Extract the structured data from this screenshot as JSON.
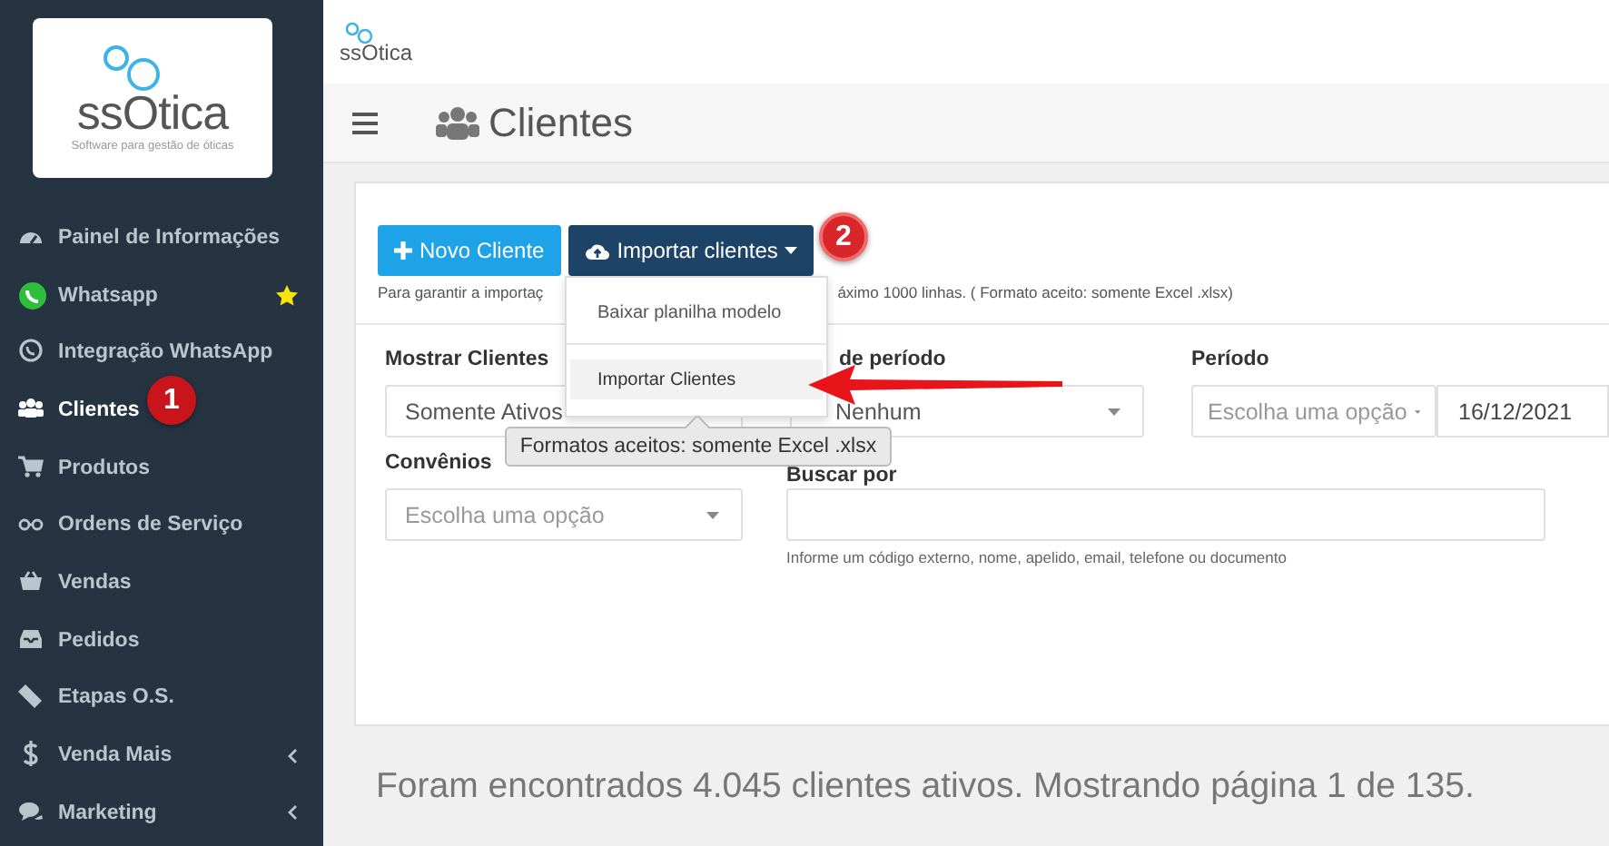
{
  "brand": {
    "logo": "ssOtica",
    "tagline": "Software para gestão de óticas",
    "header_logo": "ssOtica"
  },
  "sidebar": {
    "items": [
      {
        "label": "Painel de Informações",
        "selected": false,
        "starred": false,
        "expandable": false
      },
      {
        "label": "Whatsapp",
        "selected": false,
        "starred": true,
        "expandable": false
      },
      {
        "label": "Integração WhatsApp",
        "selected": false,
        "starred": false,
        "expandable": false
      },
      {
        "label": "Clientes",
        "selected": true,
        "starred": false,
        "expandable": false
      },
      {
        "label": "Produtos",
        "selected": false,
        "starred": false,
        "expandable": false
      },
      {
        "label": "Ordens de Serviço",
        "selected": false,
        "starred": false,
        "expandable": false
      },
      {
        "label": "Vendas",
        "selected": false,
        "starred": false,
        "expandable": false
      },
      {
        "label": "Pedidos",
        "selected": false,
        "starred": false,
        "expandable": false
      },
      {
        "label": "Etapas O.S.",
        "selected": false,
        "starred": false,
        "expandable": false
      },
      {
        "label": "Venda Mais",
        "selected": false,
        "starred": false,
        "expandable": true
      },
      {
        "label": "Marketing",
        "selected": false,
        "starred": false,
        "expandable": true
      }
    ]
  },
  "page": {
    "title": "Clientes"
  },
  "toolbar": {
    "buttons": [
      {
        "label": "Novo Cliente",
        "kind": "primary"
      },
      {
        "label": "Importar clientes",
        "kind": "dropdown"
      }
    ],
    "hint_left": "Para garantir a importaç",
    "hint_right": "áximo 1000 linhas. ( Formato aceito: somente Excel .xlsx)"
  },
  "dropdown_menu": {
    "items": [
      {
        "label": "Baixar planilha modelo",
        "selected": false
      },
      {
        "label": "Importar Clientes",
        "selected": true
      }
    ]
  },
  "tooltip": "Formatos aceitos: somente Excel .xlsx",
  "filters": {
    "show": {
      "label": "Mostrar Clientes",
      "value": "Somente Ativos"
    },
    "period_type": {
      "label": "de período",
      "value": "Nenhum"
    },
    "period": {
      "label": "Período",
      "placeholder": "Escolha uma opção",
      "date": "16/12/2021"
    },
    "agreements": {
      "label": "Convênios",
      "placeholder": "Escolha uma opção"
    },
    "search": {
      "label": "Buscar por",
      "help": "Informe um código externo, nome, apelido, email, telefone ou documento"
    }
  },
  "callouts": [
    {
      "number": "1"
    },
    {
      "number": "2"
    }
  ],
  "summary": "Foram encontrados 4.045 clientes ativos. Mostrando página 1 de 135."
}
